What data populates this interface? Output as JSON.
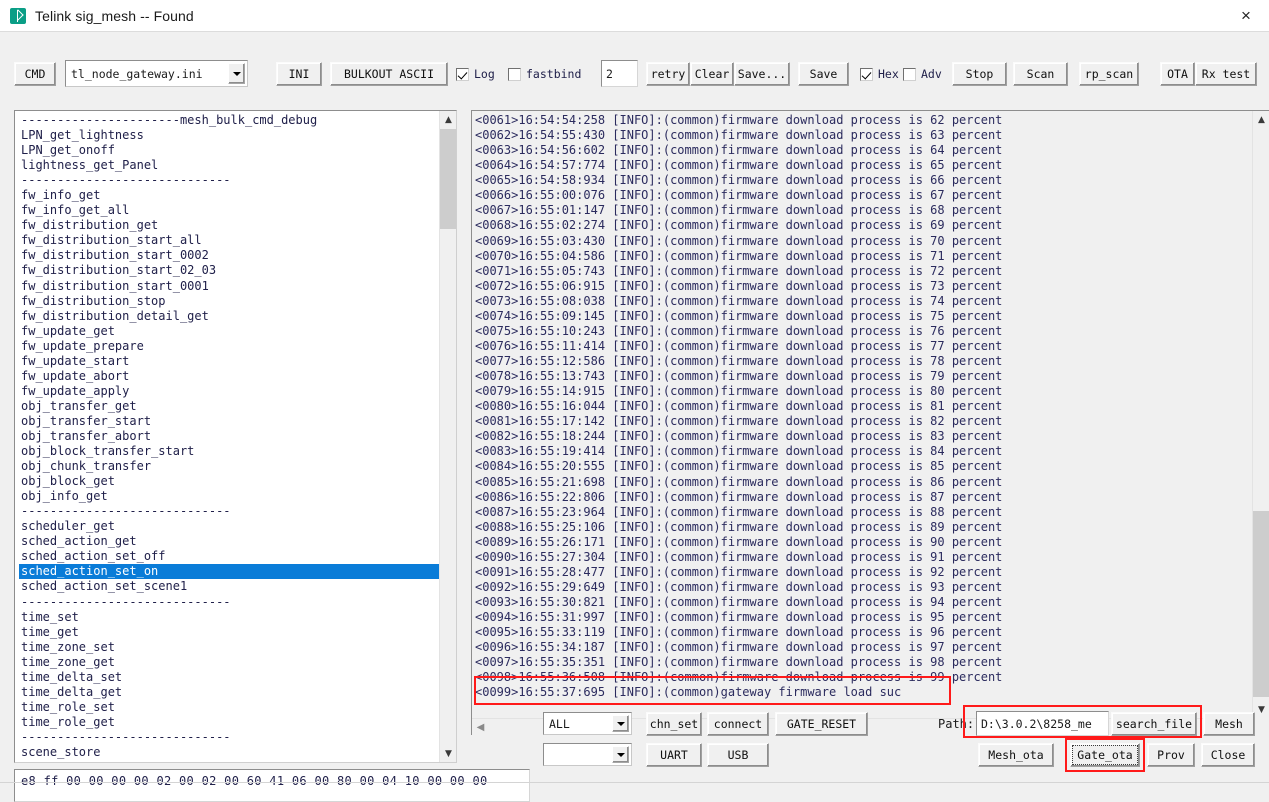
{
  "window": {
    "title": "Telink sig_mesh -- Found",
    "app_icon": "bluetooth-icon",
    "close_label": "×"
  },
  "toolbar": {
    "cmd_label": "CMD",
    "ini_file": "tl_node_gateway.ini",
    "ini_label": "INI",
    "bulkout_label": "BULKOUT ASCII",
    "log_label": "Log",
    "log_checked": true,
    "fastbind_label": "fastbind",
    "fastbind_checked": false,
    "retry_count": "2",
    "retry_label": "retry",
    "clear_label": "Clear",
    "save_as_label": "Save...",
    "save_label": "Save",
    "hex_label": "Hex",
    "hex_checked": true,
    "adv_label": "Adv",
    "adv_checked": false,
    "stop_label": "Stop",
    "scan_label": "Scan",
    "rp_scan_label": "rp_scan",
    "ota_label": "OTA",
    "rx_test_label": "Rx test"
  },
  "command_list": {
    "selected": "sched_action_set_on",
    "items": [
      "----------------------mesh_bulk_cmd_debug",
      "LPN_get_lightness",
      "LPN_get_onoff",
      "lightness_get_Panel",
      "-----------------------------",
      "fw_info_get",
      "fw_info_get_all",
      "fw_distribution_get",
      "fw_distribution_start_all",
      "fw_distribution_start_0002",
      "fw_distribution_start_02_03",
      "fw_distribution_start_0001",
      "fw_distribution_stop",
      "fw_distribution_detail_get",
      "fw_update_get",
      "fw_update_prepare",
      "fw_update_start",
      "fw_update_abort",
      "fw_update_apply",
      "obj_transfer_get",
      "obj_transfer_start",
      "obj_transfer_abort",
      "obj_block_transfer_start",
      "obj_chunk_transfer",
      "obj_block_get",
      "obj_info_get",
      "-----------------------------",
      "scheduler_get",
      "sched_action_get",
      "sched_action_set_off",
      "sched_action_set_on",
      "sched_action_set_scene1",
      "-----------------------------",
      "time_set",
      "time_get",
      "time_zone_set",
      "time_zone_get",
      "time_delta_set",
      "time_delta_get",
      "time_role_set",
      "time_role_get",
      "-----------------------------",
      "scene_store"
    ]
  },
  "log": {
    "highlighted_line_index": 38,
    "lines": [
      "<0061>16:54:54:258 [INFO]:(common)firmware download process is 62 percent",
      "<0062>16:54:55:430 [INFO]:(common)firmware download process is 63 percent",
      "<0063>16:54:56:602 [INFO]:(common)firmware download process is 64 percent",
      "<0064>16:54:57:774 [INFO]:(common)firmware download process is 65 percent",
      "<0065>16:54:58:934 [INFO]:(common)firmware download process is 66 percent",
      "<0066>16:55:00:076 [INFO]:(common)firmware download process is 67 percent",
      "<0067>16:55:01:147 [INFO]:(common)firmware download process is 68 percent",
      "<0068>16:55:02:274 [INFO]:(common)firmware download process is 69 percent",
      "<0069>16:55:03:430 [INFO]:(common)firmware download process is 70 percent",
      "<0070>16:55:04:586 [INFO]:(common)firmware download process is 71 percent",
      "<0071>16:55:05:743 [INFO]:(common)firmware download process is 72 percent",
      "<0072>16:55:06:915 [INFO]:(common)firmware download process is 73 percent",
      "<0073>16:55:08:038 [INFO]:(common)firmware download process is 74 percent",
      "<0074>16:55:09:145 [INFO]:(common)firmware download process is 75 percent",
      "<0075>16:55:10:243 [INFO]:(common)firmware download process is 76 percent",
      "<0076>16:55:11:414 [INFO]:(common)firmware download process is 77 percent",
      "<0077>16:55:12:586 [INFO]:(common)firmware download process is 78 percent",
      "<0078>16:55:13:743 [INFO]:(common)firmware download process is 79 percent",
      "<0079>16:55:14:915 [INFO]:(common)firmware download process is 80 percent",
      "<0080>16:55:16:044 [INFO]:(common)firmware download process is 81 percent",
      "<0081>16:55:17:142 [INFO]:(common)firmware download process is 82 percent",
      "<0082>16:55:18:244 [INFO]:(common)firmware download process is 83 percent",
      "<0083>16:55:19:414 [INFO]:(common)firmware download process is 84 percent",
      "<0084>16:55:20:555 [INFO]:(common)firmware download process is 85 percent",
      "<0085>16:55:21:698 [INFO]:(common)firmware download process is 86 percent",
      "<0086>16:55:22:806 [INFO]:(common)firmware download process is 87 percent",
      "<0087>16:55:23:964 [INFO]:(common)firmware download process is 88 percent",
      "<0088>16:55:25:106 [INFO]:(common)firmware download process is 89 percent",
      "<0089>16:55:26:171 [INFO]:(common)firmware download process is 90 percent",
      "<0090>16:55:27:304 [INFO]:(common)firmware download process is 91 percent",
      "<0091>16:55:28:477 [INFO]:(common)firmware download process is 92 percent",
      "<0092>16:55:29:649 [INFO]:(common)firmware download process is 93 percent",
      "<0093>16:55:30:821 [INFO]:(common)firmware download process is 94 percent",
      "<0094>16:55:31:997 [INFO]:(common)firmware download process is 95 percent",
      "<0095>16:55:33:119 [INFO]:(common)firmware download process is 96 percent",
      "<0096>16:55:34:187 [INFO]:(common)firmware download process is 97 percent",
      "<0097>16:55:35:351 [INFO]:(common)firmware download process is 98 percent",
      "<0098>16:55:36:508 [INFO]:(common)firmware download process is 99 percent",
      "<0099>16:55:37:695 [INFO]:(common)gateway firmware load suc"
    ]
  },
  "bottom": {
    "hex_command": "e8 ff 00 00 00 00 02 00 02 00 60 41 06 00 80 00 04 10 00 00 00",
    "addr_select": "ALL",
    "port_select": "",
    "chn_set_label": "chn_set",
    "connect_label": "connect",
    "gate_reset_label": "GATE_RESET",
    "uart_label": "UART",
    "usb_label": "USB",
    "path_label": "Path:",
    "path_value": "D:\\3.0.2\\8258_me",
    "search_file_label": "search_file",
    "mesh_label": "Mesh",
    "mesh_ota_label": "Mesh_ota",
    "gate_ota_label": "Gate_ota",
    "prov_label": "Prov",
    "close_label": "Close"
  },
  "colors": {
    "selection_blue": "#0a7cd8",
    "highlight_red": "#ff1a1a",
    "window_bg": "#f0f0f0",
    "text_blue": "#20204a"
  }
}
